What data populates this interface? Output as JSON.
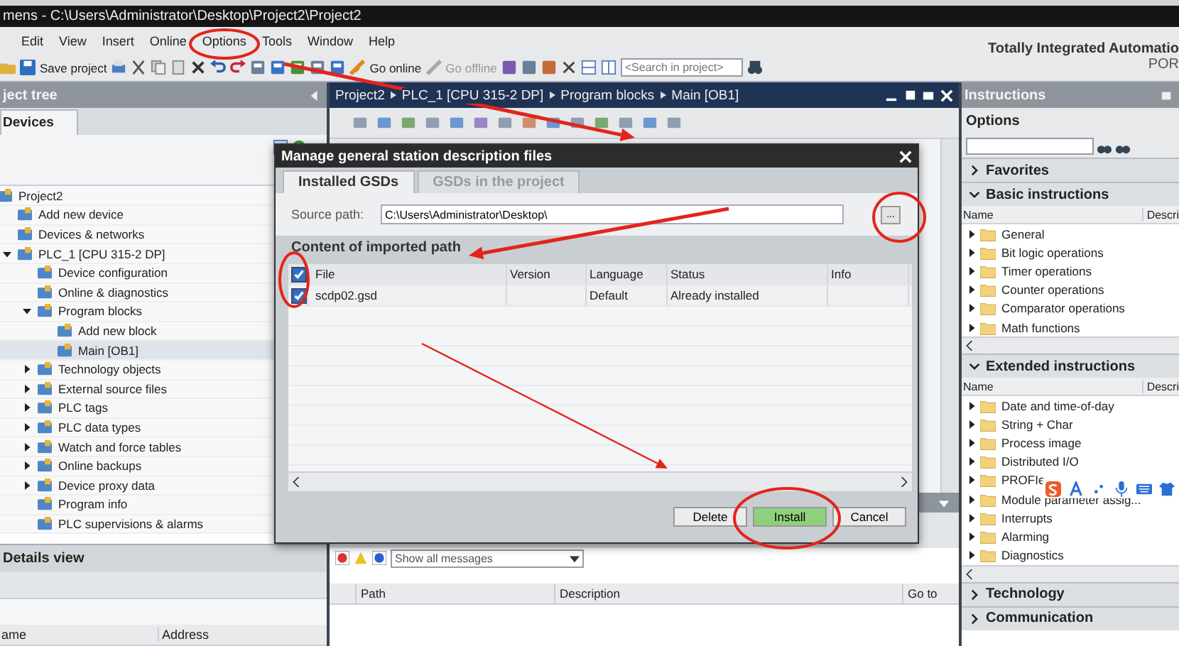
{
  "window": {
    "title": "mens - C:\\Users\\Administrator\\Desktop\\Project2\\Project2"
  },
  "menu": [
    "Edit",
    "View",
    "Insert",
    "Online",
    "Options",
    "Tools",
    "Window",
    "Help"
  ],
  "brand": {
    "line1": "Totally Integrated Automatio",
    "line2": "POR"
  },
  "toolbar": {
    "save": "Save project",
    "go_online": "Go online",
    "go_offline": "Go offline",
    "search": {
      "placeholder": "<Search in project>"
    }
  },
  "project_tree": {
    "title": "ject tree",
    "tab": "Devices",
    "items": [
      {
        "label": "Project2",
        "selected": false,
        "children": [
          {
            "label": "Add new device",
            "selected": false
          },
          {
            "label": "Devices & networks",
            "selected": false
          },
          {
            "label": "PLC_1 [CPU 315-2 DP]",
            "selected": false,
            "expanded": true,
            "children": [
              {
                "label": "Device configuration",
                "selected": false
              },
              {
                "label": "Online & diagnostics",
                "selected": false
              },
              {
                "label": "Program blocks",
                "selected": false,
                "expanded": true,
                "children": [
                  {
                    "label": "Add new block",
                    "selected": false
                  },
                  {
                    "label": "Main [OB1]",
                    "selected": true
                  }
                ]
              },
              {
                "label": "Technology objects",
                "selected": false,
                "expanded": false
              },
              {
                "label": "External source files",
                "selected": false,
                "expanded": false
              },
              {
                "label": "PLC tags",
                "selected": false,
                "expanded": false
              },
              {
                "label": "PLC data types",
                "selected": false,
                "expanded": false
              },
              {
                "label": "Watch and force tables",
                "selected": false,
                "expanded": false
              },
              {
                "label": "Online backups",
                "selected": false,
                "expanded": false
              },
              {
                "label": "Device proxy data",
                "selected": false,
                "expanded": false
              },
              {
                "label": "Program info",
                "selected": false
              },
              {
                "label": "PLC supervisions & alarms",
                "selected": false
              }
            ]
          }
        ]
      }
    ]
  },
  "details_view": {
    "title": "Details view",
    "columns": [
      "ame",
      "Address"
    ]
  },
  "editor": {
    "breadcrumb": [
      "Project2",
      "PLC_1 [CPU 315-2 DP]",
      "Program blocks",
      "Main [OB1]"
    ]
  },
  "messages": {
    "filter": "Show all messages",
    "columns": [
      "Path",
      "Description",
      "Go to"
    ]
  },
  "dialog": {
    "title": "Manage general station description files",
    "tabs": [
      {
        "label": "Installed GSDs",
        "selected": true
      },
      {
        "label": "GSDs in the project",
        "selected": false
      }
    ],
    "source_label": "Source path:",
    "source_path": "C:\\Users\\Administrator\\Desktop\\",
    "browse": "...",
    "section": "Content of imported path",
    "select_all": true,
    "columns": [
      "File",
      "Version",
      "Language",
      "Status",
      "Info"
    ],
    "rows": [
      {
        "checked": true,
        "file": "scdp02.gsd",
        "version": "",
        "language": "Default",
        "status": "Already installed",
        "info": ""
      }
    ],
    "buttons": [
      {
        "label": "Delete",
        "kind": "normal"
      },
      {
        "label": "Install",
        "kind": "primary"
      },
      {
        "label": "Cancel",
        "kind": "normal"
      }
    ]
  },
  "instructions": {
    "title": "Instructions",
    "options": "Options",
    "sections": [
      {
        "title": "Favorites",
        "expanded": false
      },
      {
        "title": "Basic instructions",
        "expanded": true,
        "columns": [
          "Name",
          "Descri"
        ],
        "items": [
          {
            "label": "General",
            "expanded": false
          },
          {
            "label": "Bit logic operations",
            "expanded": false
          },
          {
            "label": "Timer operations",
            "expanded": false
          },
          {
            "label": "Counter operations",
            "expanded": false
          },
          {
            "label": "Comparator operations",
            "expanded": false
          },
          {
            "label": "Math functions",
            "expanded": false
          }
        ]
      },
      {
        "title": "Extended instructions",
        "expanded": true,
        "columns": [
          "Name",
          "Descri"
        ],
        "items": [
          {
            "label": "Date and time-of-day",
            "expanded": false
          },
          {
            "label": "String + Char",
            "expanded": false
          },
          {
            "label": "Process image",
            "expanded": false
          },
          {
            "label": "Distributed I/O",
            "expanded": false
          },
          {
            "label": "PROFIe",
            "expanded": false
          },
          {
            "label": "Module parameter assig...",
            "expanded": false
          },
          {
            "label": "Interrupts",
            "expanded": false
          },
          {
            "label": "Alarming",
            "expanded": false
          },
          {
            "label": "Diagnostics",
            "expanded": false
          }
        ]
      },
      {
        "title": "Technology",
        "expanded": false
      },
      {
        "title": "Communication",
        "expanded": false
      }
    ]
  }
}
